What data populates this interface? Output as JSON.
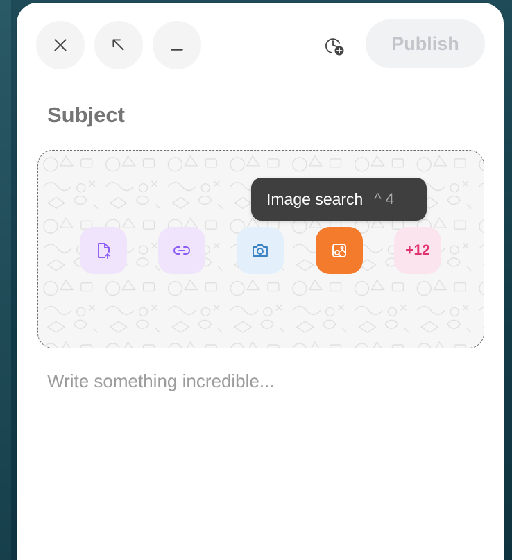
{
  "toolbar": {
    "close_icon": "close-icon",
    "expand_icon": "expand-arrow-icon",
    "minimize_icon": "minimize-icon",
    "schedule_icon": "clock-plus-icon",
    "publish_label": "Publish"
  },
  "composer": {
    "subject_placeholder": "Subject",
    "body_placeholder": "Write something incredible..."
  },
  "attachments": {
    "actions": [
      {
        "name": "upload-file",
        "icon": "file-upload-icon",
        "color": "#8b5cf6",
        "bg": "#efe4fb"
      },
      {
        "name": "attach-link",
        "icon": "link-icon",
        "color": "#8b5cf6",
        "bg": "#efe4fb"
      },
      {
        "name": "camera",
        "icon": "camera-icon",
        "color": "#3b82c4",
        "bg": "#e3f0fb"
      },
      {
        "name": "image-search",
        "icon": "image-search-icon",
        "color": "#ffffff",
        "bg": "#f47a2c"
      },
      {
        "name": "more",
        "label": "+12",
        "color": "#e0336f",
        "bg": "#fbe4ee"
      }
    ],
    "tooltip": {
      "label": "Image search",
      "shortcut": "^ 4"
    }
  }
}
